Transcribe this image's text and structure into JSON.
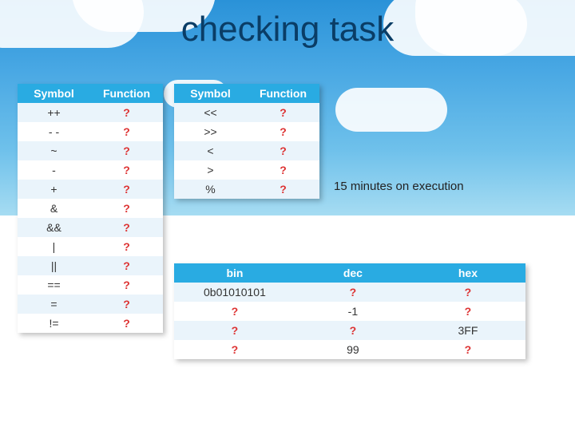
{
  "title": "checking task",
  "note": "15 minutes on execution",
  "headers": {
    "symbol": "Symbol",
    "function": "Function",
    "bin": "bin",
    "dec": "dec",
    "hex": "hex"
  },
  "table1": [
    {
      "sym": "++",
      "fn": "?"
    },
    {
      "sym": "- -",
      "fn": "?"
    },
    {
      "sym": "~",
      "fn": "?"
    },
    {
      "sym": "-",
      "fn": "?"
    },
    {
      "sym": "+",
      "fn": "?"
    },
    {
      "sym": "&",
      "fn": "?"
    },
    {
      "sym": "&&",
      "fn": "?"
    },
    {
      "sym": "|",
      "fn": "?"
    },
    {
      "sym": "||",
      "fn": "?"
    },
    {
      "sym": "==",
      "fn": "?"
    },
    {
      "sym": "=",
      "fn": "?"
    },
    {
      "sym": "!=",
      "fn": "?"
    }
  ],
  "table2": [
    {
      "sym": "<<",
      "fn": "?"
    },
    {
      "sym": ">>",
      "fn": "?"
    },
    {
      "sym": "<",
      "fn": "?"
    },
    {
      "sym": ">",
      "fn": "?"
    },
    {
      "sym": "%",
      "fn": "?"
    }
  ],
  "table3": [
    {
      "bin": "0b01010101",
      "dec": "?",
      "hex": "?"
    },
    {
      "bin": "?",
      "dec": "-1",
      "hex": "?"
    },
    {
      "bin": "?",
      "dec": "?",
      "hex": "3FF"
    },
    {
      "bin": "?",
      "dec": "99",
      "hex": "?"
    }
  ]
}
